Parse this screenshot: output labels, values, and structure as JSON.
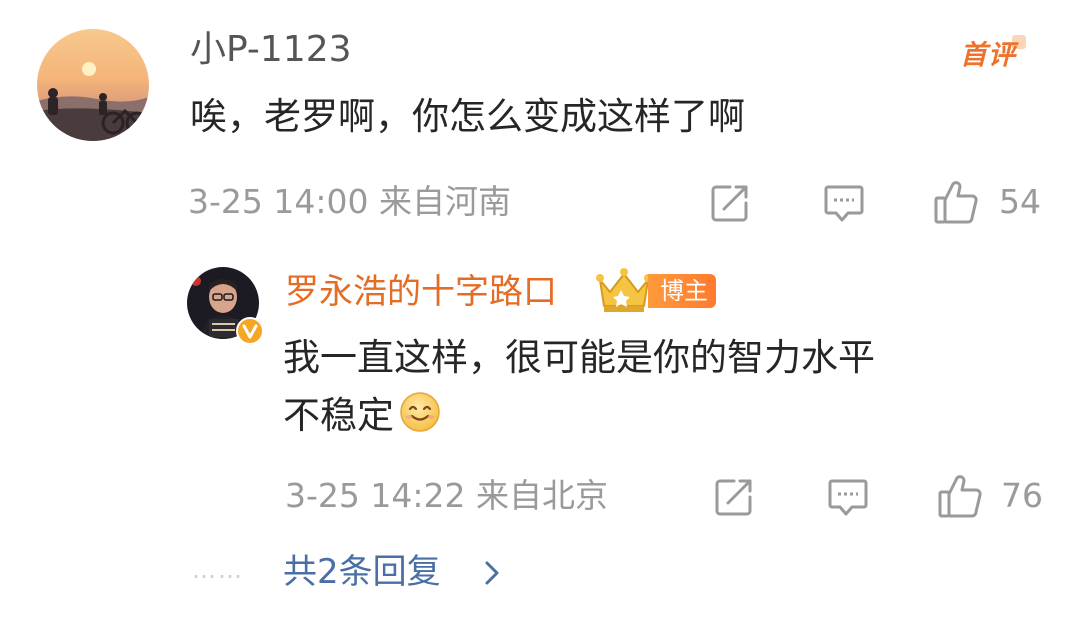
{
  "comment": {
    "username": "小P-1123",
    "first_badge": "首评",
    "text": "唉，老罗啊，你怎么变成这样了啊",
    "meta": "3-25 14:00 来自河南",
    "likes": "54"
  },
  "reply": {
    "username": "罗永浩的十字路口",
    "badge": "博主",
    "text_line1": "我一直这样，很可能是你的智力水平",
    "text_line2": "不稳定",
    "meta": "3-25 14:22 来自北京",
    "likes": "76"
  },
  "more_replies": {
    "label": "共2条回复",
    "dots": "……"
  },
  "icons": {
    "share": "share-icon",
    "comment": "comment-icon",
    "like": "thumb-up-icon",
    "chevron": "chevron-right-icon",
    "emoji": "smile-emoji-icon",
    "crown": "crown-icon",
    "verified": "verified-v-icon"
  },
  "colors": {
    "meta_gray": "#9a9a9a",
    "reply_name_orange": "#e46c25",
    "link_blue": "#4a6fa5",
    "badge_orange": "#ff8a35"
  }
}
